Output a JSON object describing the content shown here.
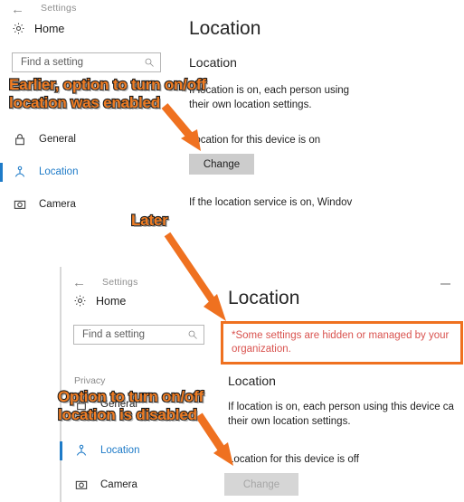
{
  "upper_window": {
    "titlebar": {
      "back_icon": "back-arrow-icon",
      "title": "Settings"
    },
    "home": {
      "icon": "gear-icon",
      "label": "Home"
    },
    "search": {
      "placeholder": "Find a setting",
      "value": "",
      "icon": "search-icon"
    },
    "nav": [
      {
        "label": "General",
        "icon": "lock-icon",
        "selected": false
      },
      {
        "label": "Location",
        "icon": "location-person-icon",
        "selected": true
      },
      {
        "label": "Camera",
        "icon": "camera-icon",
        "selected": false
      }
    ],
    "content": {
      "page_title": "Location",
      "section_title": "Location",
      "description": "If location is on, each person using\ntheir own location settings.",
      "status": "Location for this device is on",
      "change_button": "Change",
      "footer_text": "If the location service is on, Windov"
    }
  },
  "lower_window": {
    "titlebar": {
      "back_icon": "back-arrow-icon",
      "title": "Settings",
      "minimize_icon": "minimize-icon"
    },
    "home": {
      "icon": "gear-icon",
      "label": "Home"
    },
    "search": {
      "placeholder": "Find a setting",
      "value": "",
      "icon": "search-icon"
    },
    "section_header": "Privacy",
    "nav": [
      {
        "label": "General",
        "icon": "lock-icon",
        "selected": false
      },
      {
        "label": "Location",
        "icon": "location-person-icon",
        "selected": true
      },
      {
        "label": "Camera",
        "icon": "camera-icon",
        "selected": false
      }
    ],
    "content": {
      "page_title": "Location",
      "warning": "*Some settings are hidden or managed by your\norganization.",
      "section_title": "Location",
      "description": "If location is on, each person using this device ca\ntheir own location settings.",
      "status": "Location for this device is off",
      "change_button": "Change"
    }
  },
  "annotations": {
    "earlier": "Earlier, option to turn on/off\nlocation was enabled",
    "later": "Later",
    "disabled": "Option to turn on/off\nlocation is disabled"
  },
  "colors": {
    "accent_orange": "#ef7120",
    "annotation_orange": "#f07c22",
    "link_blue": "#1e7bc8",
    "warning_red": "#d9534f",
    "button_gray": "#cccccc",
    "button_disabled_gray": "#d6d6d6"
  }
}
